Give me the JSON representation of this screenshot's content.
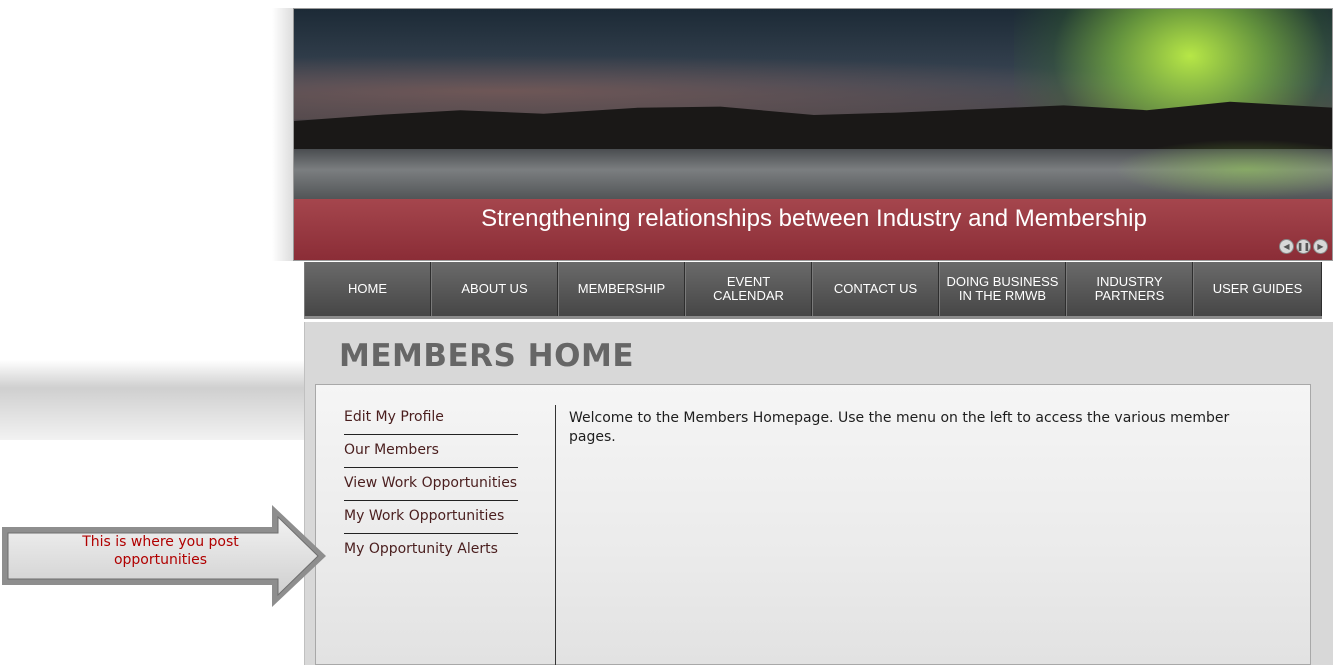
{
  "banner": {
    "caption": "Strengthening relationships between Industry and Membership",
    "controls": {
      "prev_glyph": "◀",
      "pause_glyph": "❚❚",
      "next_glyph": "▶"
    }
  },
  "nav": {
    "items": [
      {
        "label": "HOME"
      },
      {
        "label": "ABOUT US"
      },
      {
        "label": "MEMBERSHIP"
      },
      {
        "label": "EVENT CALENDAR"
      },
      {
        "label": "CONTACT US"
      },
      {
        "label": "DOING BUSINESS IN THE RMWB"
      },
      {
        "label": "INDUSTRY PARTNERS"
      },
      {
        "label": "USER GUIDES"
      }
    ]
  },
  "page": {
    "title": "MEMBERS HOME",
    "welcome": "Welcome to the Members Homepage.  Use the menu on the left to access the various member pages."
  },
  "side_menu": {
    "items": [
      {
        "label": "Edit My Profile"
      },
      {
        "label": "Our Members"
      },
      {
        "label": "View Work Opportunities"
      },
      {
        "label": "My Work Opportunities"
      },
      {
        "label": "My Opportunity Alerts"
      }
    ]
  },
  "callout": {
    "text": "This is where you post opportunities"
  },
  "colors": {
    "caption_bar": "#8a2c36",
    "nav_bg": "#464646",
    "link_text": "#4a1e1e",
    "callout_text": "#b00000"
  }
}
